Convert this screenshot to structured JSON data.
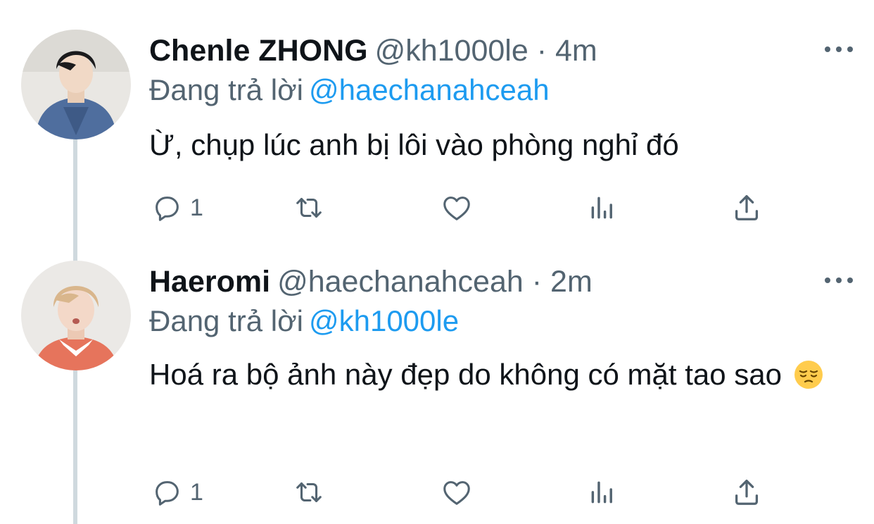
{
  "tweets": [
    {
      "display_name": "Chenle ZHONG",
      "handle": "@kh1000le",
      "separator": "·",
      "time": "4m",
      "reply_prefix": "Đang trả lời",
      "reply_to": "@haechanahceah",
      "body": "Ừ, chụp lúc anh bị lôi vào phòng nghỉ đó",
      "reply_count": "1",
      "avatar_icon": "avatar-photo"
    },
    {
      "display_name": "Haeromi",
      "handle": "@haechanahceah",
      "separator": "·",
      "time": "2m",
      "reply_prefix": "Đang trả lời",
      "reply_to": "@kh1000le",
      "body": "Hoá ra bộ ảnh này đẹp do không có mặt tao sao",
      "emoji": "pensive-face-emoji",
      "reply_count": "1",
      "avatar_icon": "avatar-photo"
    }
  ],
  "icons": {
    "reply": "comment-icon",
    "retweet": "retweet-icon",
    "like": "heart-icon",
    "views": "analytics-icon",
    "share": "share-icon",
    "more": "more-options-icon"
  },
  "colors": {
    "text": "#0f1419",
    "secondary": "#536471",
    "link": "#1d9bf0",
    "thread_line": "#cfd9de"
  }
}
